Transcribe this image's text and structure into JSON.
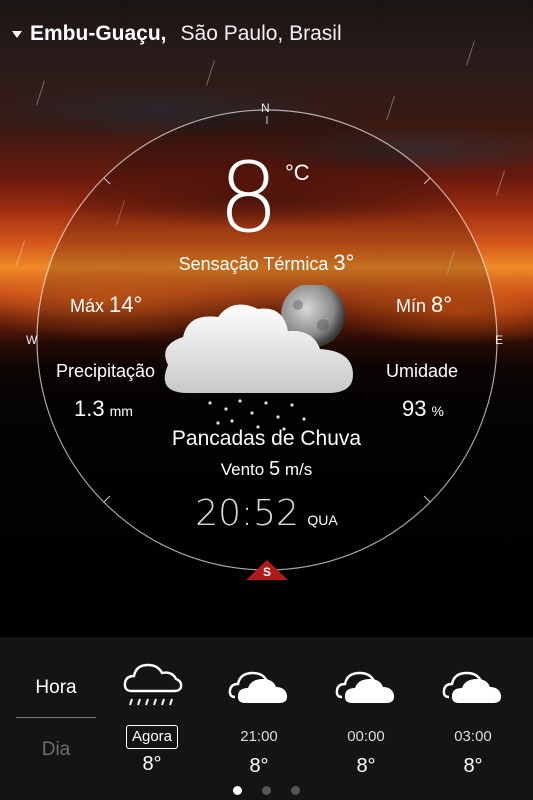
{
  "location": {
    "city": "Embu-Guaçu,",
    "region": "São Paulo, Brasil"
  },
  "compass": {
    "n": "N",
    "s": "S",
    "e": "E",
    "w": "W"
  },
  "current": {
    "temperature": "8",
    "unit": "°C",
    "feels_label": "Sensação Térmica",
    "feels_value": "3°",
    "max_label": "Máx",
    "max_value": "14°",
    "min_label": "Mín",
    "min_value": "8°",
    "precip_label": "Precipitação",
    "precip_value": "1.3",
    "precip_unit": "mm",
    "humidity_label": "Umidade",
    "humidity_value": "93",
    "humidity_unit": "%",
    "condition": "Pancadas de Chuva",
    "wind_label": "Vento",
    "wind_value": "5",
    "wind_unit": "m/s",
    "time": "20:52",
    "weekday": "QUA",
    "icon": "moon-cloud-rain-icon"
  },
  "tabs": {
    "hour": "Hora",
    "day": "Dia"
  },
  "forecast": [
    {
      "time": "Agora",
      "temp": "8°",
      "icon": "rain-cloud-icon"
    },
    {
      "time": "21:00",
      "temp": "8°",
      "icon": "cloud-icon"
    },
    {
      "time": "00:00",
      "temp": "8°",
      "icon": "cloud-icon"
    },
    {
      "time": "03:00",
      "temp": "8°",
      "icon": "cloud-icon"
    }
  ],
  "pagination": {
    "count": 3,
    "active": 1
  },
  "colors": {
    "south_marker": "#b01a1a",
    "bottom_bar": "#141414",
    "inactive_tab": "#6d6d6d"
  }
}
